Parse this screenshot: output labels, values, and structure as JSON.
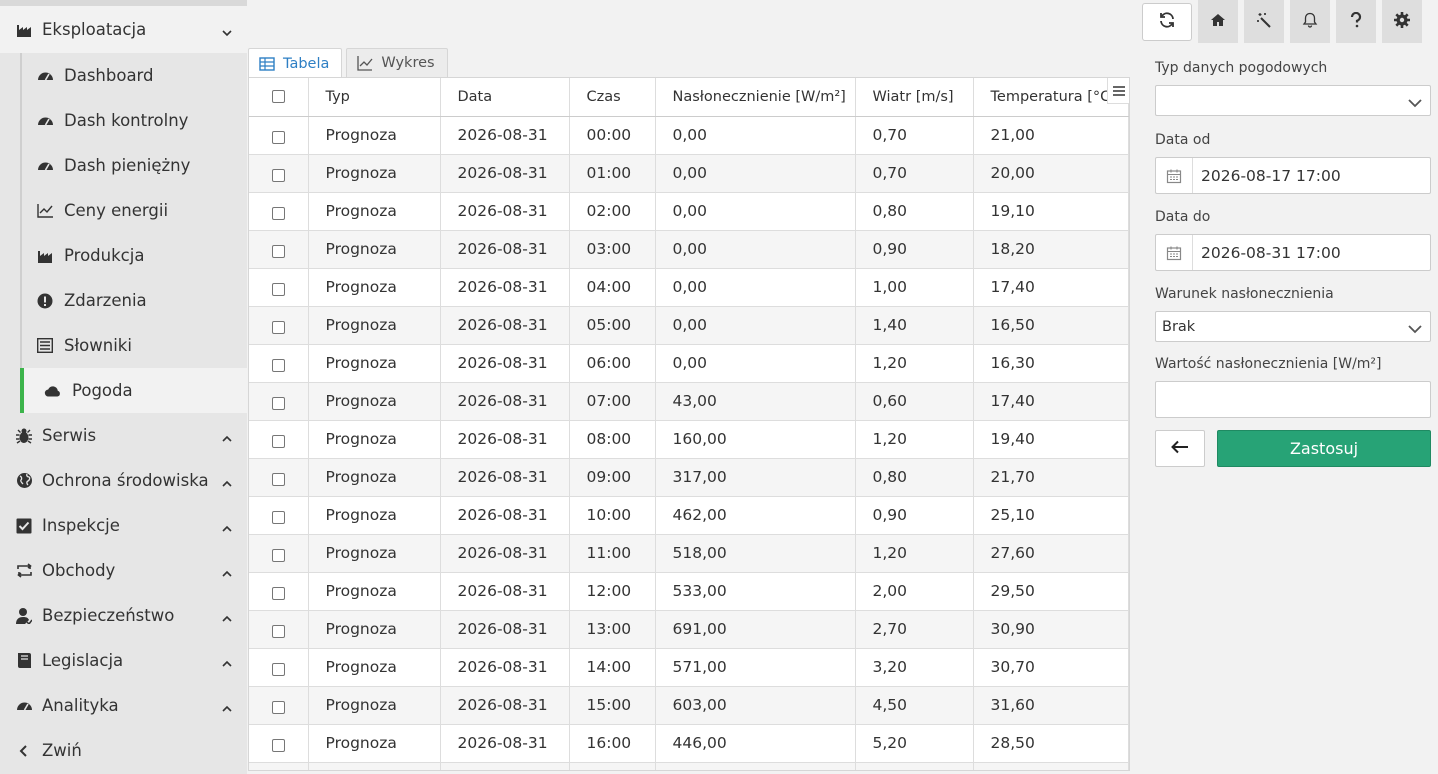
{
  "sidebar": {
    "expanded_section": "Eksploatacja",
    "subitems": [
      {
        "label": "Dashboard",
        "icon": "gauge-icon"
      },
      {
        "label": "Dash kontrolny",
        "icon": "gauge-icon"
      },
      {
        "label": "Dash pieniężny",
        "icon": "gauge-icon"
      },
      {
        "label": "Ceny energii",
        "icon": "line-chart-icon"
      },
      {
        "label": "Produkcja",
        "icon": "factory-icon"
      },
      {
        "label": "Zdarzenia",
        "icon": "alert-icon"
      },
      {
        "label": "Słowniki",
        "icon": "list-icon"
      },
      {
        "label": "Pogoda",
        "icon": "cloud-icon"
      }
    ],
    "sections": [
      {
        "label": "Serwis",
        "icon": "bug-icon"
      },
      {
        "label": "Ochrona środowiska",
        "icon": "globe-icon"
      },
      {
        "label": "Inspekcje",
        "icon": "checkbox-icon"
      },
      {
        "label": "Obchody",
        "icon": "rotate-icon"
      },
      {
        "label": "Bezpieczeństwo",
        "icon": "user-icon"
      },
      {
        "label": "Legislacja",
        "icon": "book-icon"
      },
      {
        "label": "Analityka",
        "icon": "gauge-icon"
      }
    ],
    "collapse_label": "Zwiń",
    "accent": "#3cb44b"
  },
  "tabs": [
    {
      "label": "Tabela",
      "active": true
    },
    {
      "label": "Wykres",
      "active": false
    }
  ],
  "table": {
    "columns": [
      "Typ",
      "Data",
      "Czas",
      "Nasłonecznienie [W/m²]",
      "Wiatr [m/s]",
      "Temperatura [°C]"
    ],
    "rows": [
      [
        "Prognoza",
        "2026-08-31",
        "00:00",
        "0,00",
        "0,70",
        "21,00"
      ],
      [
        "Prognoza",
        "2026-08-31",
        "01:00",
        "0,00",
        "0,70",
        "20,00"
      ],
      [
        "Prognoza",
        "2026-08-31",
        "02:00",
        "0,00",
        "0,80",
        "19,10"
      ],
      [
        "Prognoza",
        "2026-08-31",
        "03:00",
        "0,00",
        "0,90",
        "18,20"
      ],
      [
        "Prognoza",
        "2026-08-31",
        "04:00",
        "0,00",
        "1,00",
        "17,40"
      ],
      [
        "Prognoza",
        "2026-08-31",
        "05:00",
        "0,00",
        "1,40",
        "16,50"
      ],
      [
        "Prognoza",
        "2026-08-31",
        "06:00",
        "0,00",
        "1,20",
        "16,30"
      ],
      [
        "Prognoza",
        "2026-08-31",
        "07:00",
        "43,00",
        "0,60",
        "17,40"
      ],
      [
        "Prognoza",
        "2026-08-31",
        "08:00",
        "160,00",
        "1,20",
        "19,40"
      ],
      [
        "Prognoza",
        "2026-08-31",
        "09:00",
        "317,00",
        "0,80",
        "21,70"
      ],
      [
        "Prognoza",
        "2026-08-31",
        "10:00",
        "462,00",
        "0,90",
        "25,10"
      ],
      [
        "Prognoza",
        "2026-08-31",
        "11:00",
        "518,00",
        "1,20",
        "27,60"
      ],
      [
        "Prognoza",
        "2026-08-31",
        "12:00",
        "533,00",
        "2,00",
        "29,50"
      ],
      [
        "Prognoza",
        "2026-08-31",
        "13:00",
        "691,00",
        "2,70",
        "30,90"
      ],
      [
        "Prognoza",
        "2026-08-31",
        "14:00",
        "571,00",
        "3,20",
        "30,70"
      ],
      [
        "Prognoza",
        "2026-08-31",
        "15:00",
        "603,00",
        "4,50",
        "31,60"
      ],
      [
        "Prognoza",
        "2026-08-31",
        "16:00",
        "446,00",
        "5,20",
        "28,50"
      ]
    ]
  },
  "filters": {
    "weather_type_label": "Typ danych pogodowych",
    "weather_type_value": "",
    "date_from_label": "Data od",
    "date_from_value": "2026-08-17 17:00",
    "date_to_label": "Data do",
    "date_to_value": "2026-08-31 17:00",
    "condition_label": "Warunek nasłonecznienia",
    "condition_value": "Brak",
    "insolation_label": "Wartość nasłonecznienia [W/m²]",
    "insolation_value": "",
    "apply_label": "Zastosuj",
    "apply_color": "#27a376"
  },
  "toolbar": [
    "refresh-icon",
    "home-icon",
    "magic-wand-icon",
    "bell-icon",
    "help-icon",
    "gear-icon"
  ]
}
